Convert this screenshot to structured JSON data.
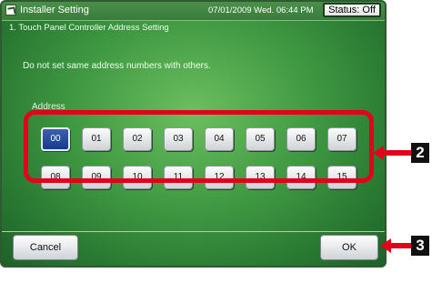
{
  "header": {
    "title": "Installer Setting",
    "datetime": "07/01/2009 Wed. 06:44 PM",
    "status_label": "Status: Off"
  },
  "main": {
    "heading": "1. Touch Panel Controller Address Setting",
    "note": "Do not set same address numbers with others.",
    "address_label": "Address",
    "addresses": [
      "00",
      "01",
      "02",
      "03",
      "04",
      "05",
      "06",
      "07",
      "08",
      "09",
      "10",
      "11",
      "12",
      "13",
      "14",
      "15"
    ],
    "selected": "00"
  },
  "footer": {
    "cancel_label": "Cancel",
    "ok_label": "OK"
  },
  "annotations": {
    "badge_2": "2",
    "badge_3": "3"
  },
  "colors": {
    "panel_green": "#3f9842",
    "annotation_red": "#e3001b",
    "selected_blue": "#163b8a"
  }
}
